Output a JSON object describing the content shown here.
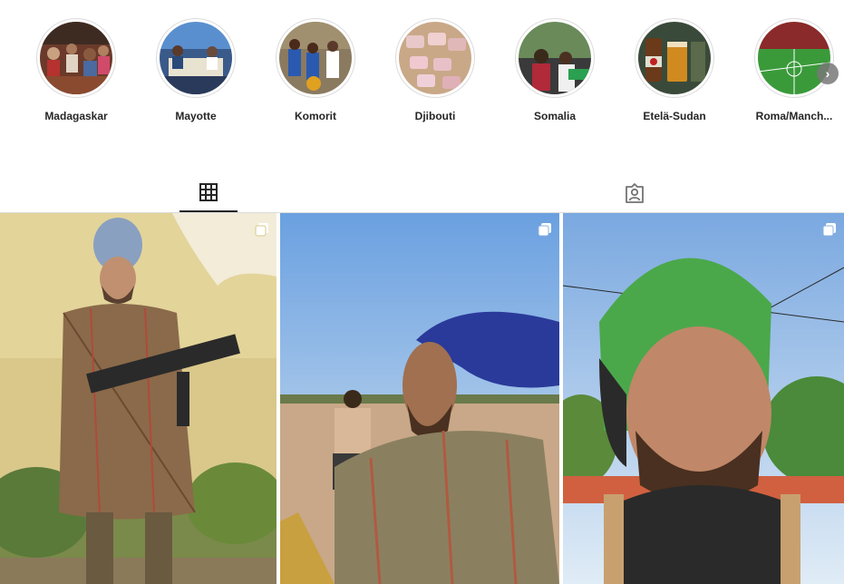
{
  "highlights": [
    {
      "label": "Madagaskar"
    },
    {
      "label": "Mayotte"
    },
    {
      "label": "Komorit"
    },
    {
      "label": "Djibouti"
    },
    {
      "label": "Somalia"
    },
    {
      "label": "Etelä-Sudan"
    },
    {
      "label": "Roma/Manch..."
    }
  ],
  "highlights_next_icon": "chevron-right-icon",
  "tabs": [
    {
      "name": "posts",
      "icon": "grid-icon",
      "active": true
    },
    {
      "name": "tagged",
      "icon": "tagged-user-icon",
      "active": false
    }
  ],
  "posts": [
    {
      "icon": "carousel-icon"
    },
    {
      "icon": "carousel-icon"
    },
    {
      "icon": "carousel-icon"
    }
  ]
}
